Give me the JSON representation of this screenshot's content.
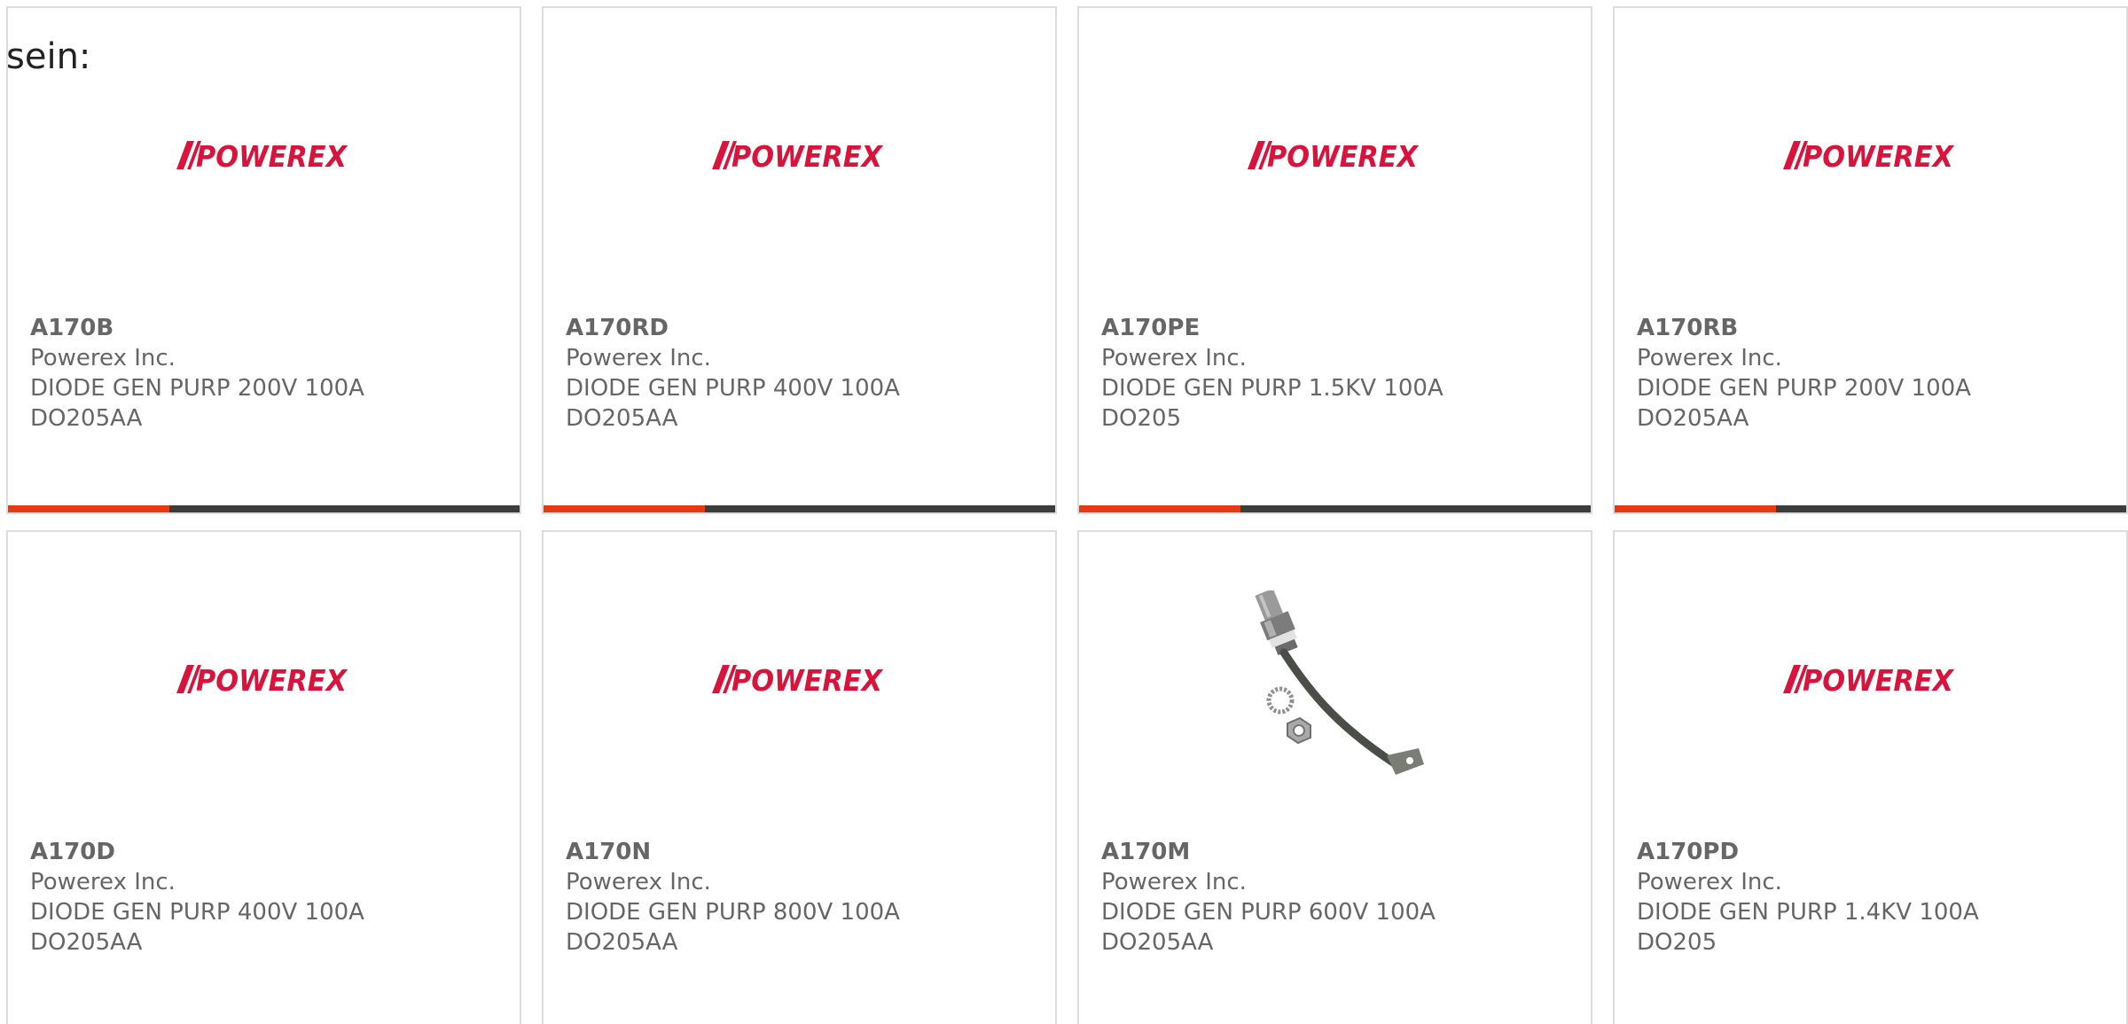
{
  "intro_text": "sein:",
  "colors": {
    "accent_bar": "#e33b12",
    "dark_bar": "#3d3d3d",
    "brand_red": "#d8143c",
    "text_gray": "#666666",
    "card_border": "#dcdcdc"
  },
  "products": [
    {
      "part_number": "A170B",
      "manufacturer": "Powerex Inc.",
      "description": "DIODE GEN PURP 200V 100A",
      "package": "DO205AA",
      "image": "powerex-logo",
      "logo_text": "POWEREX"
    },
    {
      "part_number": "A170RD",
      "manufacturer": "Powerex Inc.",
      "description": "DIODE GEN PURP 400V 100A",
      "package": "DO205AA",
      "image": "powerex-logo",
      "logo_text": "POWEREX"
    },
    {
      "part_number": "A170PE",
      "manufacturer": "Powerex Inc.",
      "description": "DIODE GEN PURP 1.5KV 100A",
      "package": "DO205",
      "image": "powerex-logo",
      "logo_text": "POWEREX"
    },
    {
      "part_number": "A170RB",
      "manufacturer": "Powerex Inc.",
      "description": "DIODE GEN PURP 200V 100A",
      "package": "DO205AA",
      "image": "powerex-logo",
      "logo_text": "POWEREX"
    },
    {
      "part_number": "A170D",
      "manufacturer": "Powerex Inc.",
      "description": "DIODE GEN PURP 400V 100A",
      "package": "DO205AA",
      "image": "powerex-logo",
      "logo_text": "POWEREX"
    },
    {
      "part_number": "A170N",
      "manufacturer": "Powerex Inc.",
      "description": "DIODE GEN PURP 800V 100A",
      "package": "DO205AA",
      "image": "powerex-logo",
      "logo_text": "POWEREX"
    },
    {
      "part_number": "A170M",
      "manufacturer": "Powerex Inc.",
      "description": "DIODE GEN PURP 600V 100A",
      "package": "DO205AA",
      "image": "stud-diode-photo"
    },
    {
      "part_number": "A170PD",
      "manufacturer": "Powerex Inc.",
      "description": "DIODE GEN PURP 1.4KV 100A",
      "package": "DO205",
      "image": "powerex-logo",
      "logo_text": "POWEREX"
    }
  ]
}
